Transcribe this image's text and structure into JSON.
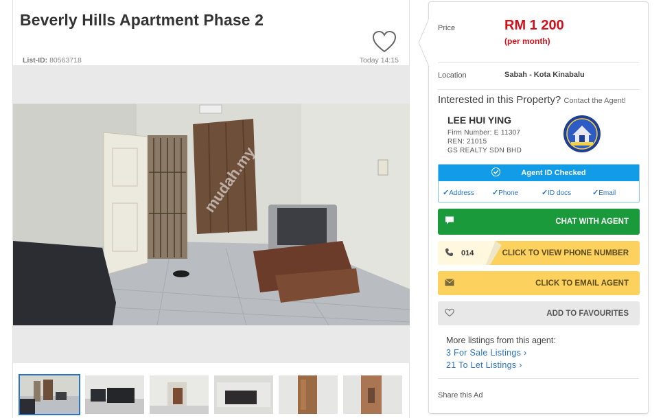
{
  "listing": {
    "title": "Beverly Hills Apartment Phase 2",
    "list_id_label": "List-ID:",
    "list_id_value": "80563718",
    "posted": "Today 14:15",
    "watermark": "mudah.my",
    "photo_count": 6
  },
  "panel": {
    "price_label": "Price",
    "price": "RM 1 200",
    "price_unit": "(per month)",
    "location_label": "Location",
    "location": "Sabah - Kota Kinabalu",
    "interest_text": "Interested in this Property?",
    "contact_text": "Contact the Agent!",
    "agent": {
      "name": "LEE HUI YING",
      "firm": "Firm Number: E 11307",
      "ren": "REN: 21015",
      "company": "GS REALTY SDN BHD"
    },
    "verification": {
      "title": "Agent ID Checked",
      "items": [
        "Address",
        "Phone",
        "ID docs",
        "Email"
      ]
    },
    "buttons": {
      "chat": "CHAT WITH AGENT",
      "phone_prefix": "014",
      "phone": "CLICK TO VIEW PHONE NUMBER",
      "email": "CLICK TO EMAIL AGENT",
      "favourite": "ADD TO FAVOURITES"
    },
    "more_listings": {
      "heading": "More listings from this agent:",
      "sale": "3 For Sale Listings ›",
      "let": "21 To Let Listings ›"
    },
    "share": "Share this Ad"
  },
  "colors": {
    "price_red": "#d0111c",
    "chat_green": "#1b9a3c",
    "yellow": "#fcd15e",
    "verify_blue": "#129be6",
    "link_blue": "#2a73c5"
  },
  "icons": [
    "heart-icon",
    "check-circle-icon",
    "check-icon",
    "chat-bubble-icon",
    "phone-icon",
    "envelope-icon",
    "heart-outline-icon"
  ]
}
